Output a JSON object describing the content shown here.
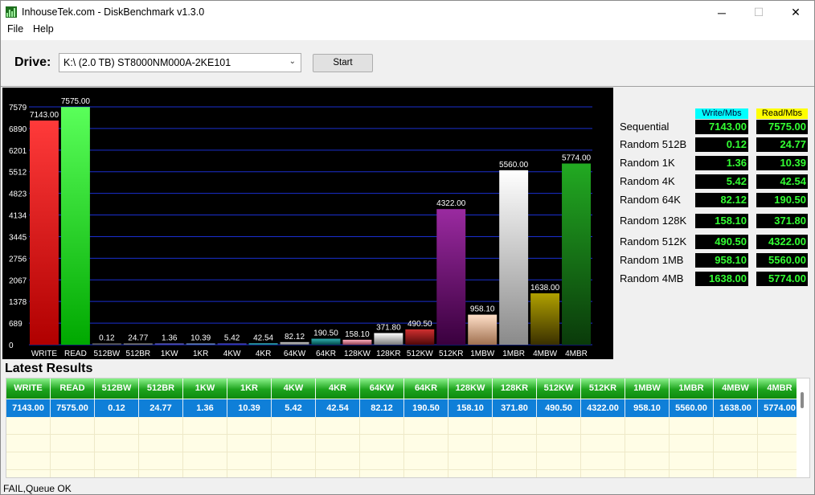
{
  "window": {
    "title": "InhouseTek.com - DiskBenchmark v1.3.0",
    "minimize_glyph": "─",
    "maximize_glyph": "☐",
    "close_glyph": "✕"
  },
  "menu": {
    "file": "File",
    "help": "Help"
  },
  "toolbar": {
    "drive_label": "Drive:",
    "drive_value": "K:\\ (2.0 TB) ST8000NM000A-2KE101",
    "start_label": "Start"
  },
  "chart_data": {
    "type": "bar",
    "categories": [
      "WRITE",
      "READ",
      "512BW",
      "512BR",
      "1KW",
      "1KR",
      "4KW",
      "4KR",
      "64KW",
      "64KR",
      "128KW",
      "128KR",
      "512KW",
      "512KR",
      "1MBW",
      "1MBR",
      "4MBW",
      "4MBR"
    ],
    "values": [
      7143.0,
      7575.0,
      0.12,
      24.77,
      1.36,
      10.39,
      5.42,
      42.54,
      82.12,
      190.5,
      158.1,
      371.8,
      490.5,
      4322.0,
      958.1,
      5560.0,
      1638.0,
      5774.0
    ],
    "value_labels": [
      "7143.00",
      "7575.00",
      "0.12",
      "24.77",
      "1.36",
      "10.39",
      "5.42",
      "42.54",
      "82.12",
      "190.50",
      "158.10",
      "371.80",
      "490.50",
      "4322.00",
      "958.10",
      "5560.00",
      "1638.00",
      "5774.00"
    ],
    "y_ticks": [
      0,
      689,
      1378,
      2067,
      2756,
      3445,
      4134,
      4823,
      5512,
      6201,
      6890,
      7579
    ],
    "ylim": [
      0,
      7579
    ],
    "grid": true,
    "colors": [
      [
        "#ff3a3a",
        "#b00000"
      ],
      [
        "#5aff5a",
        "#00a800"
      ],
      [
        "#9a9a9a",
        "#3a3a3a"
      ],
      [
        "#b5b5b5",
        "#505050"
      ],
      [
        "#8a8aff",
        "#2a2a9a"
      ],
      [
        "#a0c0ff",
        "#3050a0"
      ],
      [
        "#7070ff",
        "#1818a0"
      ],
      [
        "#50e8ff",
        "#006070"
      ],
      [
        "#e0e0e0",
        "#606060"
      ],
      [
        "#30b0b0",
        "#004848"
      ],
      [
        "#ffb0c0",
        "#904050"
      ],
      [
        "#ffffff",
        "#7a7a7a"
      ],
      [
        "#d03030",
        "#500808"
      ],
      [
        "#9a2aa0",
        "#3a003e"
      ],
      [
        "#ffe0c8",
        "#a07050"
      ],
      [
        "#ffffff",
        "#8a8a8a"
      ],
      [
        "#b0a000",
        "#3a3000"
      ],
      [
        "#22aa22",
        "#0a3a0a"
      ]
    ]
  },
  "summary": {
    "write_header": "Write/Mbs",
    "read_header": "Read/Mbs",
    "rows": [
      {
        "label": "Sequential",
        "write": "7143.00",
        "read": "7575.00"
      },
      {
        "label": "Random 512B",
        "write": "0.12",
        "read": "24.77"
      },
      {
        "label": "Random 1K",
        "write": "1.36",
        "read": "10.39"
      },
      {
        "label": "Random 4K",
        "write": "5.42",
        "read": "42.54"
      },
      {
        "label": "Random 64K",
        "write": "82.12",
        "read": "190.50"
      },
      {
        "label": "Random 128K",
        "write": "158.10",
        "read": "371.80"
      },
      {
        "label": "Random 512K",
        "write": "490.50",
        "read": "4322.00"
      },
      {
        "label": "Random 1MB",
        "write": "958.10",
        "read": "5560.00"
      },
      {
        "label": "Random 4MB",
        "write": "1638.00",
        "read": "5774.00"
      }
    ]
  },
  "results": {
    "title": "Latest Results",
    "columns": [
      "WRITE",
      "READ",
      "512BW",
      "512BR",
      "1KW",
      "1KR",
      "4KW",
      "4KR",
      "64KW",
      "64KR",
      "128KW",
      "128KR",
      "512KW",
      "512KR",
      "1MBW",
      "1MBR",
      "4MBW",
      "4MBR"
    ],
    "row": [
      "7143.00",
      "7575.00",
      "0.12",
      "24.77",
      "1.36",
      "10.39",
      "5.42",
      "42.54",
      "82.12",
      "190.50",
      "158.10",
      "371.80",
      "490.50",
      "4322.00",
      "958.10",
      "5560.00",
      "1638.00",
      "5774.00"
    ]
  },
  "status": {
    "text": "FAIL,Queue OK"
  }
}
